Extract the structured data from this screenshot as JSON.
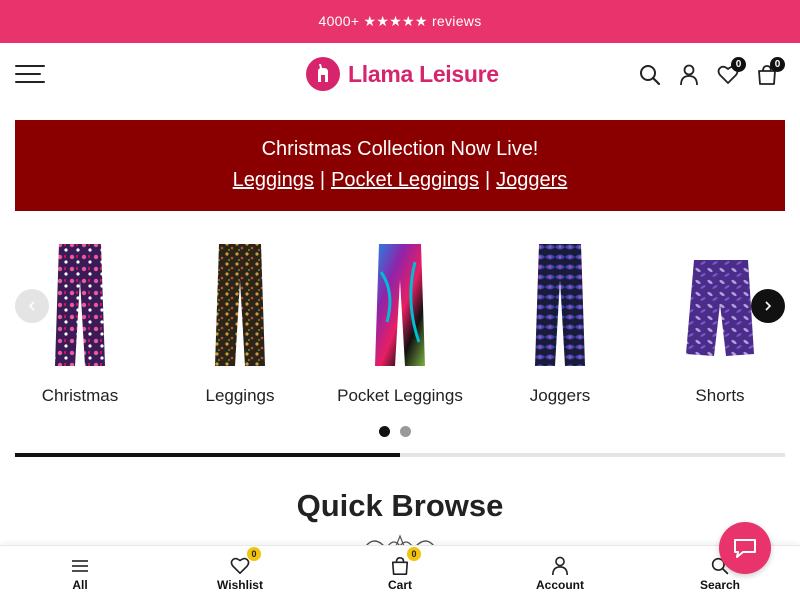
{
  "announcement": {
    "text": "4000+ ★★★★★ reviews"
  },
  "header": {
    "logo_text": "Llama Leisure",
    "wishlist_count": "0",
    "cart_count": "0",
    "icons": [
      "menu-icon",
      "search-icon",
      "account-icon",
      "heart-icon",
      "shopping-bag-icon"
    ]
  },
  "promo": {
    "title": "Christmas Collection Now Live!",
    "links": [
      "Leggings",
      "Pocket Leggings",
      "Joggers"
    ],
    "separator": "|"
  },
  "carousel": {
    "items": [
      {
        "label": "Christmas"
      },
      {
        "label": "Leggings"
      },
      {
        "label": "Pocket Leggings"
      },
      {
        "label": "Joggers"
      },
      {
        "label": "Shorts"
      }
    ],
    "page_count": 2,
    "active_page": 1,
    "progress_fraction": 0.5
  },
  "section": {
    "title": "Quick Browse"
  },
  "toolbar": {
    "items": [
      {
        "label": "All",
        "icon": "menu-icon"
      },
      {
        "label": "Wishlist",
        "icon": "heart-icon",
        "badge": "0"
      },
      {
        "label": "Cart",
        "icon": "shopping-bag-icon",
        "badge": "0"
      },
      {
        "label": "Account",
        "icon": "account-icon"
      },
      {
        "label": "Search",
        "icon": "search-icon"
      }
    ]
  },
  "colors": {
    "announcement_bg": "#e8336d",
    "brand": "#d6246d",
    "promo_bg": "#8a0000",
    "toolbar_badge": "#f1c40f"
  }
}
